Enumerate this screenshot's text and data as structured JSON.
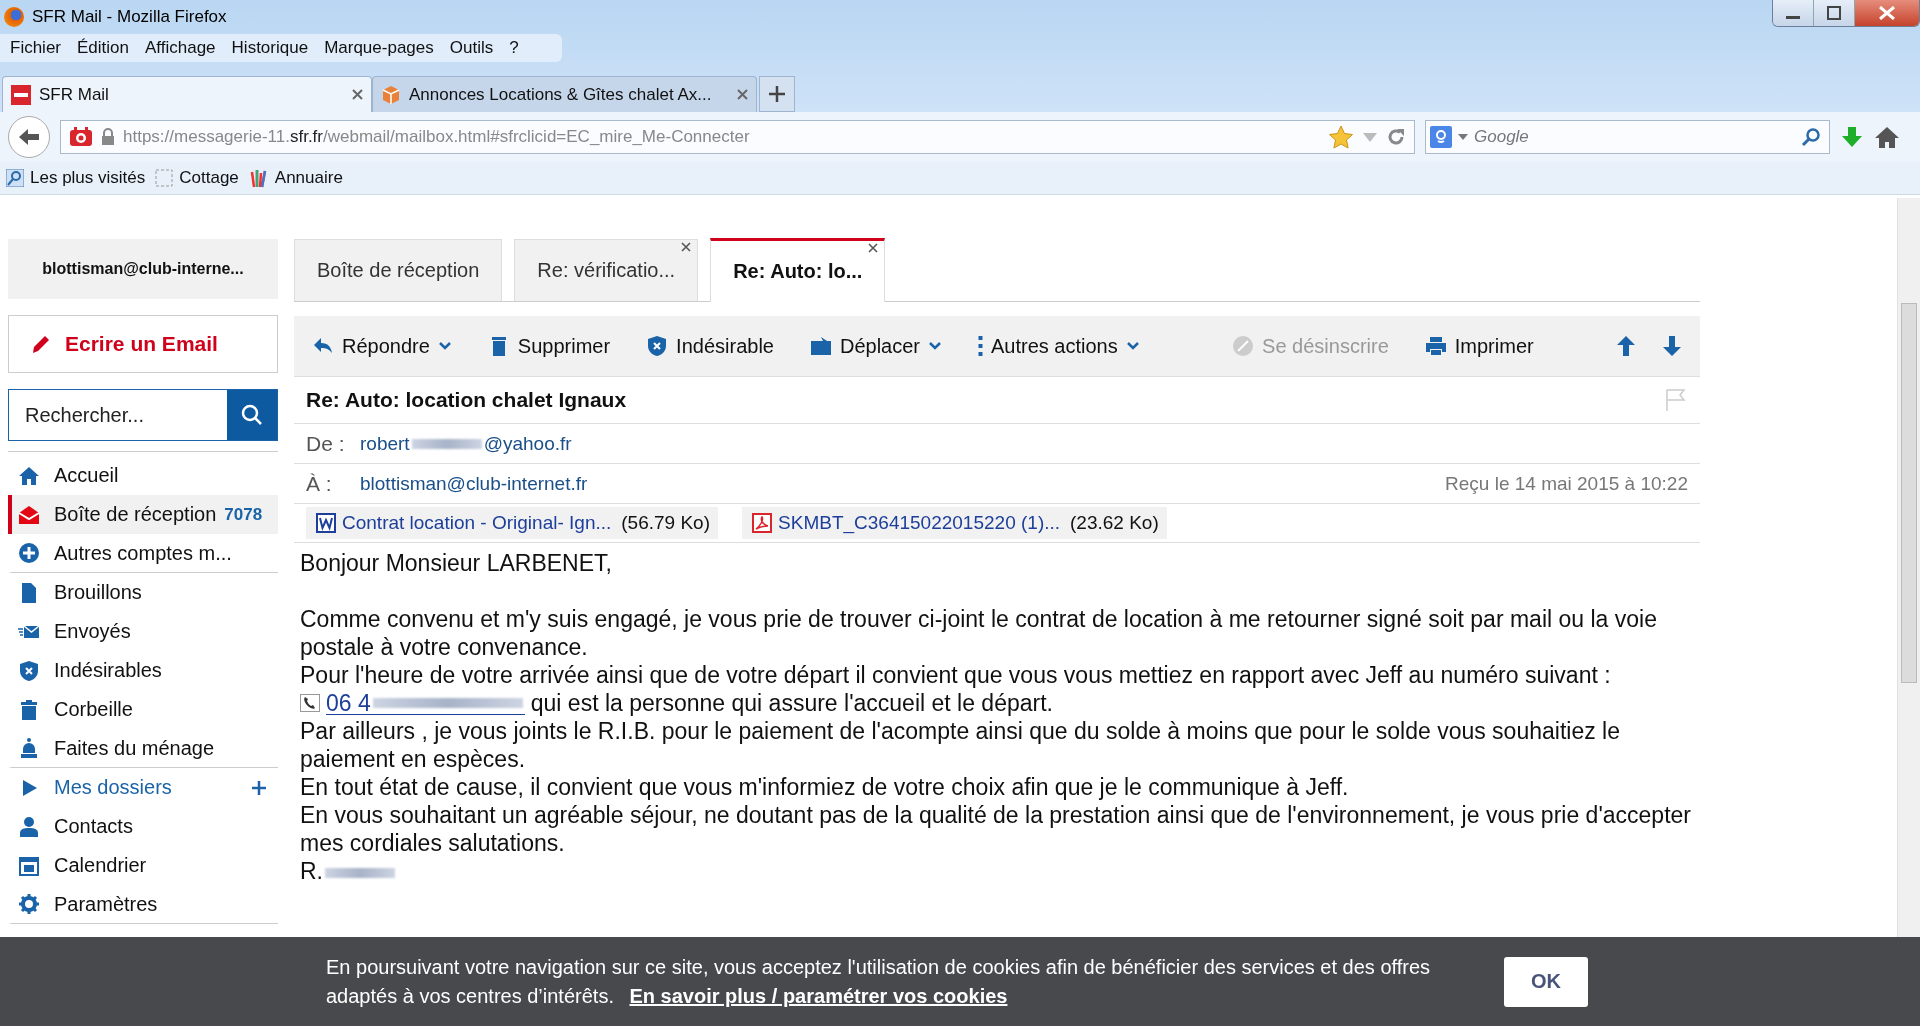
{
  "window": {
    "title": "SFR Mail - Mozilla Firefox"
  },
  "menu": [
    "Fichier",
    "Édition",
    "Affichage",
    "Historique",
    "Marque-pages",
    "Outils",
    "?"
  ],
  "browser_tabs": [
    {
      "label": "SFR Mail",
      "selected": true
    },
    {
      "label": "Annonces Locations & Gîtes chalet Ax...",
      "selected": false
    }
  ],
  "address_bar": {
    "prefix": "https://messagerie-11.",
    "domain": "sfr.fr",
    "path": "/webmail/mailbox.html#sfrclicid=EC_mire_Me-Connecter"
  },
  "search_bar": {
    "placeholder": "Google"
  },
  "bookmarks": [
    "Les plus visités",
    "Cottage",
    "Annuaire"
  ],
  "sidebar": {
    "account": "blottisman@club-interne...",
    "compose": "Ecrire un Email",
    "search": {
      "placeholder": "Rechercher..."
    },
    "items": [
      {
        "label": "Accueil",
        "selected": false,
        "kind": "plain",
        "divider": false
      },
      {
        "label": "Boîte de réception",
        "count": "7078",
        "selected": true,
        "kind": "plain",
        "divider": false
      },
      {
        "label": "Autres comptes m...",
        "selected": false,
        "kind": "plain",
        "divider": true
      },
      {
        "label": "Brouillons",
        "selected": false,
        "kind": "plain",
        "divider": false
      },
      {
        "label": "Envoyés",
        "selected": false,
        "kind": "plain",
        "divider": false
      },
      {
        "label": "Indésirables",
        "selected": false,
        "kind": "plain",
        "divider": false
      },
      {
        "label": "Corbeille",
        "selected": false,
        "kind": "plain",
        "divider": false
      },
      {
        "label": "Faites du ménage",
        "selected": false,
        "kind": "plain",
        "divider": true
      },
      {
        "label": "Mes dossiers",
        "selected": false,
        "kind": "folder",
        "divider": false
      },
      {
        "label": "Contacts",
        "selected": false,
        "kind": "plain",
        "divider": false
      },
      {
        "label": "Calendrier",
        "selected": false,
        "kind": "plain",
        "divider": false
      },
      {
        "label": "Paramètres",
        "selected": false,
        "kind": "plain",
        "divider": true
      }
    ]
  },
  "mail_tabs": [
    {
      "label": "Boîte de réception",
      "selected": false,
      "closable": false
    },
    {
      "label": "Re: vérificatio...",
      "selected": false,
      "closable": true
    },
    {
      "label": "Re: Auto: lo...",
      "selected": true,
      "closable": true
    }
  ],
  "toolbar": [
    {
      "label": "Répondre",
      "dropdown": true,
      "disabled": false
    },
    {
      "label": "Supprimer",
      "dropdown": false,
      "disabled": false
    },
    {
      "label": "Indésirable",
      "dropdown": false,
      "disabled": false
    },
    {
      "label": "Déplacer",
      "dropdown": true,
      "disabled": false
    },
    {
      "label": "Autres actions",
      "dropdown": true,
      "disabled": false
    },
    {
      "label": "Se désinscrire",
      "dropdown": false,
      "disabled": true
    },
    {
      "label": "Imprimer",
      "dropdown": false,
      "disabled": false
    }
  ],
  "message": {
    "subject": "Re: Auto: location chalet Ignaux",
    "from_label": "De :",
    "from_start": "robert",
    "from_end": "@yahoo.fr",
    "to_label": "À :",
    "to": "blottisman@club-internet.fr",
    "received": "Reçu le 14 mai 2015 à 10:22",
    "attachments": [
      {
        "kind": "word",
        "name": "Contrat location - Original- Ign...",
        "size": "(56.79 Ko)"
      },
      {
        "kind": "pdf",
        "name": "SKMBT_C36415022015220 (1)...",
        "size": "(23.62 Ko)"
      }
    ],
    "greeting": "Bonjour Monsieur LARBENET,",
    "paragraphs": [
      "Comme convenu et m'y suis engagé, je vous prie de trouver ci-joint le contrat de location à me retourner signé soit par mail ou la voie postale à votre convenance.",
      "Pour l'heure de votre arrivée ainsi que de votre départ il convient que vous vous mettiez en rapport avec Jeff au numéro suivant :"
    ],
    "phone": "06 4",
    "phone_after": "qui est la personne qui assure l'accueil et le départ.",
    "paragraphs_after": [
      "Par ailleurs , je vous joints le R.I.B. pour le paiement de l'acompte ainsi que du solde à moins que pour le solde vous souhaitiez le paiement en espèces.",
      "En tout état de cause, il convient que vous m'informiez de votre choix afin que je le communique à Jeff.",
      "En vous souhaitant un agréable séjour, ne doutant pas de la qualité de la prestation ainsi que de l'environnement, je vous prie d'accepter mes cordiales salutations."
    ],
    "signature": "R."
  },
  "cookie_banner": {
    "text": "En poursuivant votre navigation sur ce site, vous acceptez l'utilisation de cookies afin de bénéficier des services et des offres adaptés à vos centres d’intérêts.",
    "link": "En savoir plus / paramétrer vos cookies",
    "button": "OK"
  }
}
